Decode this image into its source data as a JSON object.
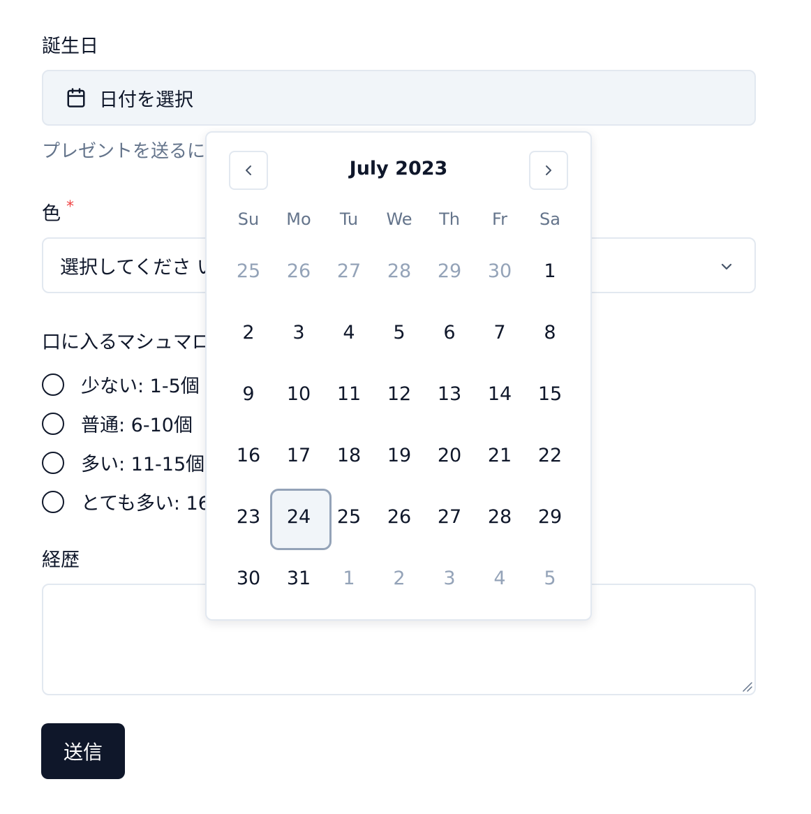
{
  "form": {
    "birthday_label": "誕生日",
    "date_placeholder": "日付を選択",
    "birthday_helper": "プレゼントを送るに",
    "color_label": "色",
    "required_mark": "*",
    "color_select_value": "選択してくださ い",
    "marshmallow_label": "口に入るマシュマロ",
    "radio_options": [
      "少ない: 1-5個",
      "普通: 6-10個",
      "多い: 11-15個",
      "とても多い: 16"
    ],
    "bio_label": "経歴",
    "bio_value": "",
    "submit_label": "送信"
  },
  "calendar": {
    "month_title": "July 2023",
    "weekdays": [
      "Su",
      "Mo",
      "Tu",
      "We",
      "Th",
      "Fr",
      "Sa"
    ],
    "selected_day": 24,
    "weeks": [
      [
        {
          "d": "25",
          "o": true
        },
        {
          "d": "26",
          "o": true
        },
        {
          "d": "27",
          "o": true
        },
        {
          "d": "28",
          "o": true
        },
        {
          "d": "29",
          "o": true
        },
        {
          "d": "30",
          "o": true
        },
        {
          "d": "1",
          "o": false
        }
      ],
      [
        {
          "d": "2",
          "o": false
        },
        {
          "d": "3",
          "o": false
        },
        {
          "d": "4",
          "o": false
        },
        {
          "d": "5",
          "o": false
        },
        {
          "d": "6",
          "o": false
        },
        {
          "d": "7",
          "o": false
        },
        {
          "d": "8",
          "o": false
        }
      ],
      [
        {
          "d": "9",
          "o": false
        },
        {
          "d": "10",
          "o": false
        },
        {
          "d": "11",
          "o": false
        },
        {
          "d": "12",
          "o": false
        },
        {
          "d": "13",
          "o": false
        },
        {
          "d": "14",
          "o": false
        },
        {
          "d": "15",
          "o": false
        }
      ],
      [
        {
          "d": "16",
          "o": false
        },
        {
          "d": "17",
          "o": false
        },
        {
          "d": "18",
          "o": false
        },
        {
          "d": "19",
          "o": false
        },
        {
          "d": "20",
          "o": false
        },
        {
          "d": "21",
          "o": false
        },
        {
          "d": "22",
          "o": false
        }
      ],
      [
        {
          "d": "23",
          "o": false
        },
        {
          "d": "24",
          "o": false
        },
        {
          "d": "25",
          "o": false
        },
        {
          "d": "26",
          "o": false
        },
        {
          "d": "27",
          "o": false
        },
        {
          "d": "28",
          "o": false
        },
        {
          "d": "29",
          "o": false
        }
      ],
      [
        {
          "d": "30",
          "o": false
        },
        {
          "d": "31",
          "o": false
        },
        {
          "d": "1",
          "o": true
        },
        {
          "d": "2",
          "o": true
        },
        {
          "d": "3",
          "o": true
        },
        {
          "d": "4",
          "o": true
        },
        {
          "d": "5",
          "o": true
        }
      ]
    ]
  },
  "icons": {
    "calendar": "calendar-icon",
    "prev": "chevron-left-icon",
    "next": "chevron-right-icon",
    "dropdown": "chevron-down-icon"
  },
  "colors": {
    "primary": "#0f172a",
    "muted": "#64748b",
    "required": "#ef4444",
    "border": "#e2e8f0",
    "field_bg": "#f1f5f9"
  }
}
